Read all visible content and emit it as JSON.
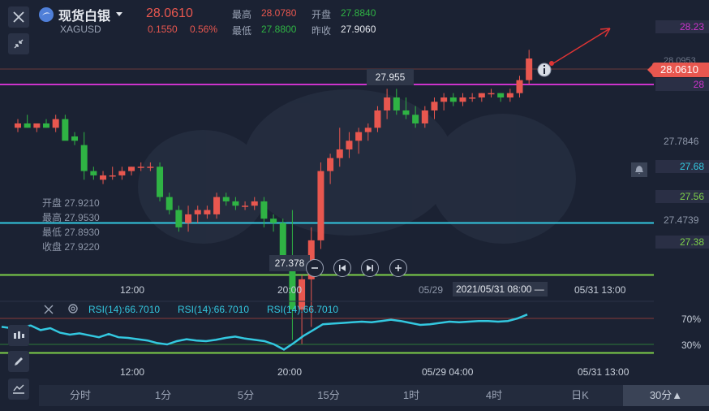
{
  "header": {
    "symbol_name": "现货白银",
    "symbol_code": "XAGUSD",
    "price": "28.0610",
    "change": "0.1550",
    "change_pct": "0.56%",
    "high_label": "最高",
    "high_value": "28.0780",
    "low_label": "最低",
    "low_value": "27.8800",
    "open_label": "开盘",
    "open_value": "27.8840",
    "prev_close_label": "昨收",
    "prev_close_value": "27.9060"
  },
  "price_axis": {
    "tick_top": "28.0953",
    "tick_mid": "27.7846",
    "tick_low": "27.4739",
    "current": "28.0610"
  },
  "lines": [
    {
      "label": "28.23",
      "color": "#cc33cc"
    },
    {
      "label": "28",
      "color": "#cc33cc"
    },
    {
      "label": "27.68",
      "color": "#33c8e0"
    },
    {
      "label": "27.56",
      "color": "#7ed04a"
    },
    {
      "label": "27.38",
      "color": "#7ed04a"
    }
  ],
  "crosshair": {
    "price_tooltip": "27.955",
    "low_tooltip": "27.378",
    "date_tooltip": "2021/05/31 08:00 —"
  },
  "ohlc_info": {
    "open": "开盘 27.9210",
    "high": "最高 27.9530",
    "low": "最低 27.8930",
    "close": "收盘 27.9220"
  },
  "time_axis": [
    "12:00",
    "20:00",
    "05/29",
    "05/31 13:00"
  ],
  "rsi": {
    "labels": [
      "RSI(14):66.7010",
      "RSI(14):66.7010",
      "RSI(14):66.7010"
    ],
    "level_high": "70%",
    "level_low": "30%",
    "time_axis": [
      "12:00",
      "20:00",
      "05/29 04:00",
      "05/31 13:00"
    ]
  },
  "tabs": [
    "分时",
    "1分",
    "5分",
    "15分",
    "1时",
    "4时",
    "日K",
    "30分▲"
  ],
  "colors": {
    "up": "#e8574f",
    "down": "#2fb344",
    "bg": "#1b2233"
  },
  "chart_data": {
    "type": "candlestick",
    "candles": [
      [
        27.9,
        27.92,
        27.89,
        27.91
      ],
      [
        27.91,
        27.93,
        27.9,
        27.9
      ],
      [
        27.9,
        27.91,
        27.89,
        27.91
      ],
      [
        27.91,
        27.92,
        27.9,
        27.9
      ],
      [
        27.9,
        27.93,
        27.89,
        27.92
      ],
      [
        27.92,
        27.93,
        27.88,
        27.87
      ],
      [
        27.88,
        27.89,
        27.86,
        27.87
      ],
      [
        27.86,
        27.89,
        27.78,
        27.8
      ],
      [
        27.8,
        27.81,
        27.78,
        27.79
      ],
      [
        27.78,
        27.8,
        27.77,
        27.79
      ],
      [
        27.79,
        27.81,
        27.78,
        27.79
      ],
      [
        27.79,
        27.81,
        27.78,
        27.8
      ],
      [
        27.8,
        27.81,
        27.79,
        27.81
      ],
      [
        27.81,
        27.82,
        27.8,
        27.81
      ],
      [
        27.81,
        27.82,
        27.8,
        27.81
      ],
      [
        27.81,
        27.82,
        27.73,
        27.74
      ],
      [
        27.74,
        27.75,
        27.7,
        27.71
      ],
      [
        27.71,
        27.72,
        27.66,
        27.67
      ],
      [
        27.68,
        27.72,
        27.66,
        27.7
      ],
      [
        27.7,
        27.72,
        27.68,
        27.71
      ],
      [
        27.7,
        27.72,
        27.69,
        27.71
      ],
      [
        27.7,
        27.75,
        27.69,
        27.74
      ],
      [
        27.74,
        27.75,
        27.72,
        27.73
      ],
      [
        27.73,
        27.74,
        27.71,
        27.72
      ],
      [
        27.72,
        27.73,
        27.71,
        27.72
      ],
      [
        27.72,
        27.74,
        27.71,
        27.73
      ],
      [
        27.73,
        27.74,
        27.67,
        27.69
      ],
      [
        27.69,
        27.7,
        27.66,
        27.68
      ],
      [
        27.68,
        27.69,
        27.59,
        27.6
      ],
      [
        27.6,
        27.71,
        27.41,
        27.48
      ],
      [
        27.48,
        27.56,
        27.4,
        27.55
      ],
      [
        27.55,
        27.67,
        27.44,
        27.64
      ],
      [
        27.64,
        27.82,
        27.62,
        27.8
      ],
      [
        27.8,
        27.84,
        27.77,
        27.83
      ],
      [
        27.83,
        27.9,
        27.81,
        27.85
      ],
      [
        27.85,
        27.89,
        27.83,
        27.87
      ],
      [
        27.87,
        27.9,
        27.84,
        27.89
      ],
      [
        27.89,
        27.91,
        27.87,
        27.9
      ],
      [
        27.9,
        27.95,
        27.89,
        27.94
      ],
      [
        27.94,
        27.99,
        27.92,
        27.97
      ],
      [
        27.97,
        27.99,
        27.93,
        27.94
      ],
      [
        27.94,
        27.97,
        27.92,
        27.93
      ],
      [
        27.93,
        27.95,
        27.9,
        27.91
      ],
      [
        27.91,
        27.95,
        27.9,
        27.94
      ],
      [
        27.94,
        27.97,
        27.92,
        27.96
      ],
      [
        27.96,
        27.98,
        27.94,
        27.97
      ],
      [
        27.97,
        27.98,
        27.95,
        27.96
      ],
      [
        27.96,
        27.98,
        27.95,
        27.97
      ],
      [
        27.97,
        27.98,
        27.96,
        27.97
      ],
      [
        27.97,
        27.98,
        27.96,
        27.98
      ],
      [
        27.98,
        27.99,
        27.97,
        27.98
      ],
      [
        27.98,
        27.98,
        27.96,
        27.97
      ],
      [
        27.97,
        27.99,
        27.96,
        27.98
      ],
      [
        27.98,
        28.02,
        27.97,
        28.01
      ],
      [
        28.01,
        28.08,
        28.0,
        28.06
      ]
    ],
    "rsi": [
      57,
      55,
      57,
      59,
      52,
      55,
      48,
      45,
      47,
      44,
      41,
      46,
      41,
      40,
      38,
      36,
      32,
      30,
      35,
      38,
      36,
      35,
      37,
      40,
      42,
      39,
      37,
      35,
      30,
      22,
      32,
      43,
      52,
      61,
      62,
      63,
      64,
      65,
      64,
      66,
      68,
      66,
      63,
      60,
      61,
      63,
      65,
      64,
      65,
      66,
      66,
      65,
      66,
      70,
      76
    ]
  }
}
